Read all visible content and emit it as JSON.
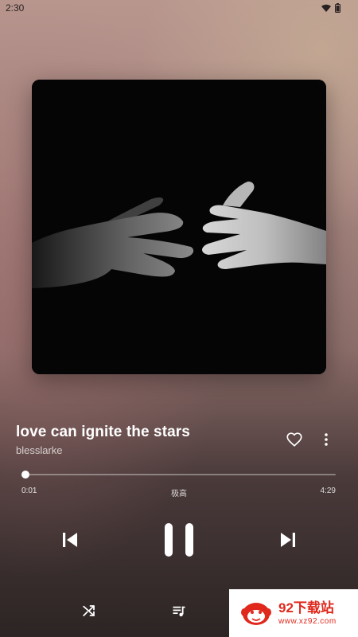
{
  "status_bar": {
    "time": "2:30",
    "icons": [
      "wifi-icon",
      "battery-icon"
    ]
  },
  "album_art": {
    "description_icon": "album-cover-image"
  },
  "track": {
    "title": "love can ignite the stars",
    "artist": "blesslarke",
    "liked": false
  },
  "playback": {
    "elapsed": "0:01",
    "total": "4:29",
    "quality": "极高",
    "progress_fraction": 0.004,
    "state": "playing"
  },
  "controls": {
    "icons": [
      "previous-icon",
      "pause-icon",
      "next-icon",
      "shuffle-icon",
      "queue-icon",
      "heart-icon",
      "more-icon"
    ]
  },
  "watermark": {
    "brand": "92下载站",
    "url": "www.xz92.com"
  },
  "colors": {
    "accent": "#ffffff",
    "watermark_red": "#e0281c"
  }
}
